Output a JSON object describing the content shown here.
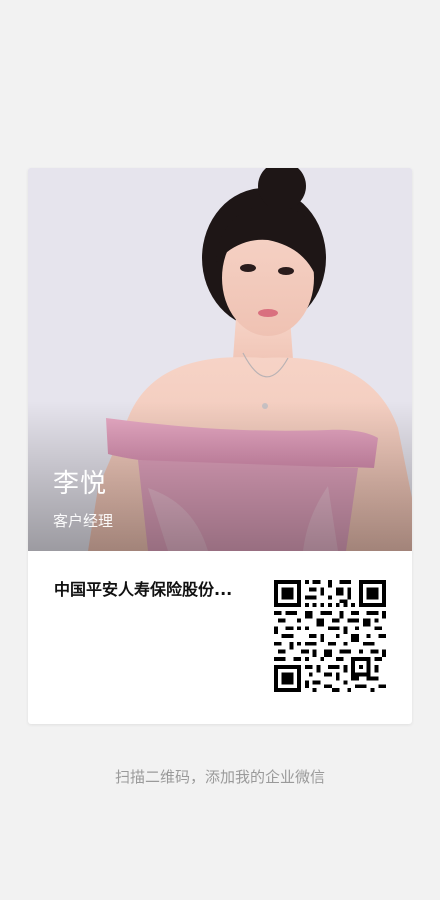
{
  "card": {
    "name": "李悦",
    "job_title": "客户经理",
    "company": "中国平安人寿保险股份..."
  },
  "hint": {
    "text": "扫描二维码，添加我的企业微信"
  },
  "colors": {
    "background": "#f2f2f2",
    "card": "#ffffff",
    "hint_text": "#9a9a9a",
    "company_text": "#111111"
  }
}
